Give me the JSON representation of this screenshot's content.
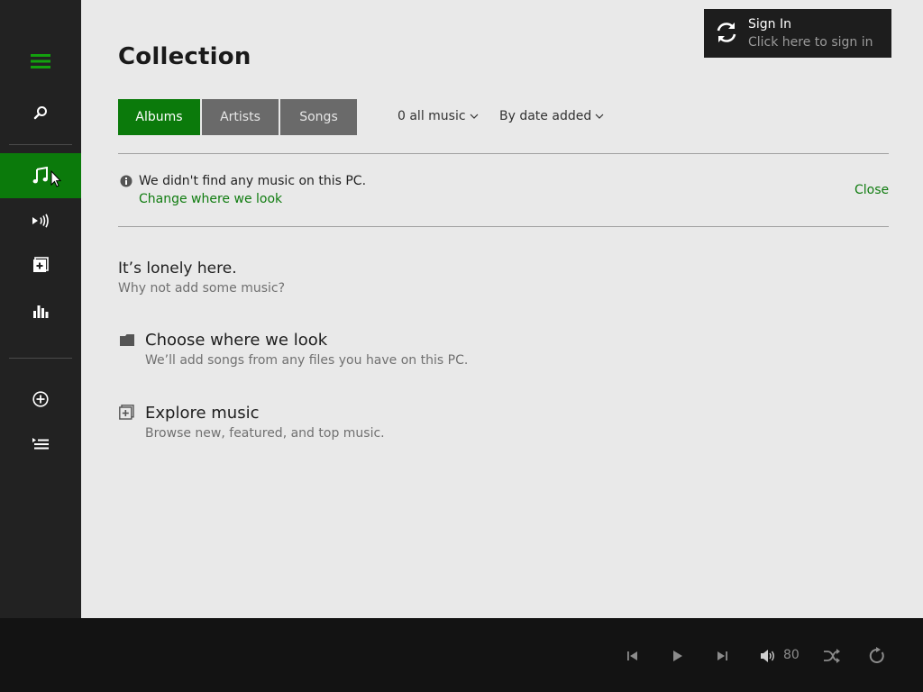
{
  "sidebar": {
    "items": [
      {
        "name": "hamburger-menu",
        "icon": "hamburger-icon"
      },
      {
        "name": "search",
        "icon": "search-icon"
      },
      {
        "name": "collection",
        "icon": "music-note-icon",
        "active": true
      },
      {
        "name": "now-playing",
        "icon": "radio-icon"
      },
      {
        "name": "explore",
        "icon": "explore-icon"
      },
      {
        "name": "charts",
        "icon": "bar-chart-icon"
      },
      {
        "name": "new-playlist",
        "icon": "add-circle-icon"
      },
      {
        "name": "playlists",
        "icon": "playlist-icon"
      }
    ]
  },
  "header": {
    "title": "Collection"
  },
  "signin": {
    "title": "Sign In",
    "subtitle": "Click here to sign in"
  },
  "tabs": [
    {
      "label": "Albums",
      "active": true
    },
    {
      "label": "Artists",
      "active": false
    },
    {
      "label": "Songs",
      "active": false
    }
  ],
  "filters": {
    "source": "0 all music",
    "sort": "By date added"
  },
  "notice": {
    "message": "We didn't find any music on this PC.",
    "link": "Change where we look",
    "close": "Close"
  },
  "empty_state": {
    "title": "It’s lonely here.",
    "subtitle": "Why not add some music?"
  },
  "actions": [
    {
      "title": "Choose where we look",
      "subtitle": "We’ll add songs from any files you have on this PC.",
      "icon": "folder-icon"
    },
    {
      "title": "Explore music",
      "subtitle": "Browse new, featured, and top music.",
      "icon": "explore-icon"
    }
  ],
  "player": {
    "volume": "80",
    "controls": [
      "previous-icon",
      "play-icon",
      "next-icon",
      "volume-icon",
      "shuffle-icon",
      "repeat-icon"
    ]
  },
  "colors": {
    "accent": "#0b7a0b",
    "link": "#107c10",
    "sidebar": "#222222",
    "background": "#e9e9e9",
    "player_bar": "#131313"
  }
}
